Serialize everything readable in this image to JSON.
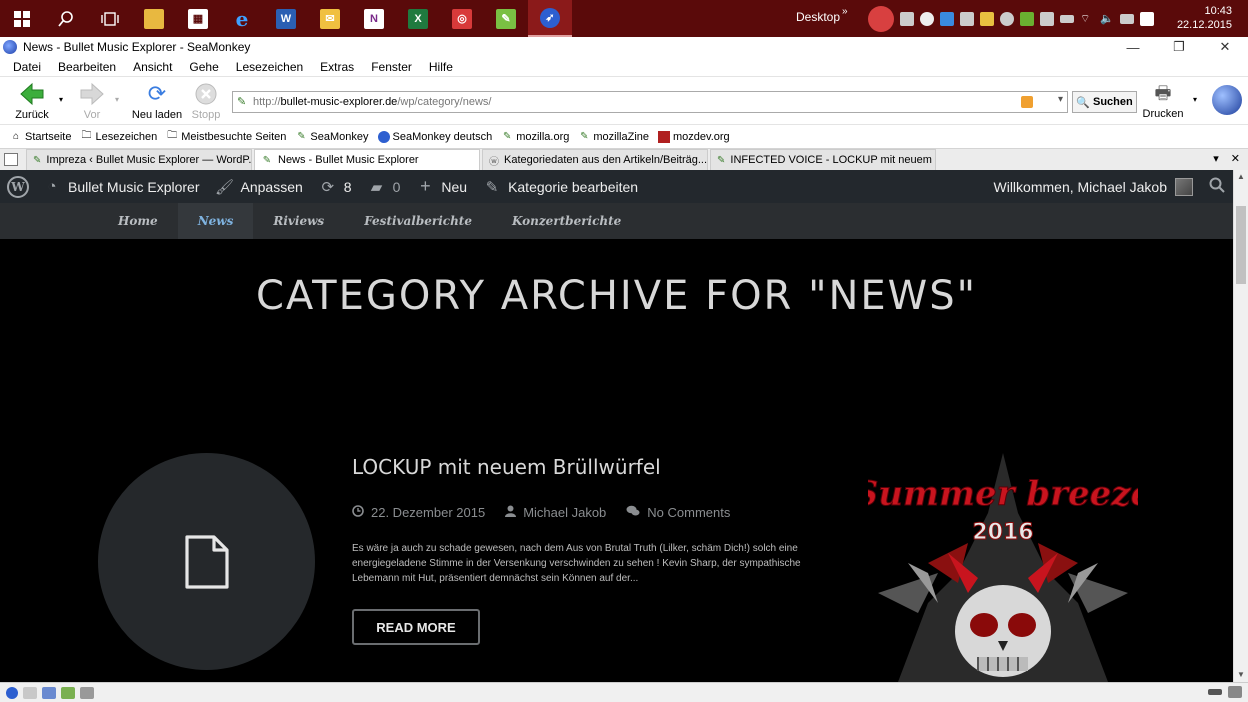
{
  "taskbar": {
    "desktop_label": "Desktop",
    "time": "10:43",
    "date": "22.12.2015"
  },
  "window": {
    "title": "News - Bullet Music Explorer - SeaMonkey"
  },
  "menu": {
    "items": [
      "Datei",
      "Bearbeiten",
      "Ansicht",
      "Gehe",
      "Lesezeichen",
      "Extras",
      "Fenster",
      "Hilfe"
    ]
  },
  "toolbar": {
    "back_label": "Zurück",
    "forward_label": "Vor",
    "reload_label": "Neu laden",
    "stop_label": "Stopp",
    "url_prefix": "http://",
    "url_domain": "bullet-music-explorer.de",
    "url_path": "/wp/category/news/",
    "search_label": "Suchen",
    "print_label": "Drucken"
  },
  "bookmarks": [
    "Startseite",
    "Lesezeichen",
    "Meistbesuchte Seiten",
    "SeaMonkey",
    "SeaMonkey deutsch",
    "mozilla.org",
    "mozillaZine",
    "mozdev.org"
  ],
  "tabs": [
    {
      "label": "Impreza ‹ Bullet Music Explorer — WordP..."
    },
    {
      "label": "News - Bullet Music Explorer"
    },
    {
      "label": "Kategoriedaten aus den Artikeln/Beiträg..."
    },
    {
      "label": "INFECTED VOICE - LOCKUP mit neuem B..."
    }
  ],
  "wp_adminbar": {
    "site_name": "Bullet Music Explorer",
    "customize": "Anpassen",
    "updates_count": "8",
    "comments_count": "0",
    "new_label": "Neu",
    "edit_category": "Kategorie bearbeiten",
    "welcome": "Willkommen, Michael Jakob"
  },
  "site_nav": [
    "Home",
    "News",
    "Riviews",
    "Festivalberichte",
    "Konzertberichte"
  ],
  "page": {
    "heading": "CATEGORY ARCHIVE FOR \"NEWS\""
  },
  "post": {
    "title": "LOCKUP mit neuem Brüllwürfel",
    "date": "22. Dezember 2015",
    "author": "Michael Jakob",
    "comments": "No Comments",
    "excerpt": "Es wäre ja auch zu schade gewesen, nach dem Aus von Brutal Truth (Lilker, schäm Dich!) solch eine energiegeladene Stimme in der Versenkung verschwinden zu sehen ! Kevin Sharp, der sympathische Lebemann mit Hut, präsentiert demnächst sein Können auf der...",
    "read_more": "READ MORE",
    "poster_text_1": "Summer breeze",
    "poster_text_2": "2016"
  },
  "colors": {
    "taskbar_bg": "#5a0a0a",
    "wp_bar_bg": "#23282d",
    "site_nav_bg": "#2b2e31",
    "nav_active": "#7fb3e0",
    "poster_red": "#c8141e"
  }
}
